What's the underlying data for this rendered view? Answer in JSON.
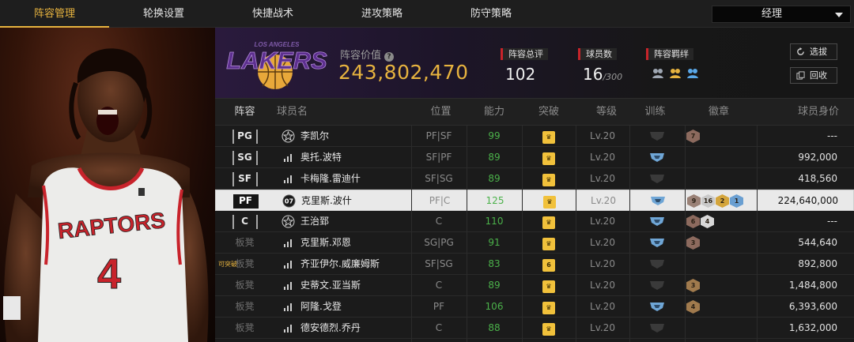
{
  "tabs": [
    {
      "label": "阵容管理",
      "active": true
    },
    {
      "label": "轮换设置",
      "active": false
    },
    {
      "label": "快捷战术",
      "active": false
    },
    {
      "label": "进攻策略",
      "active": false
    },
    {
      "label": "防守策略",
      "active": false
    }
  ],
  "role_select": {
    "value": "经理"
  },
  "player_art": {
    "jersey_text": "RAPTORS",
    "jersey_number": "4"
  },
  "team": {
    "logo_text": "LAKERS",
    "logo_subtext": "LOS ANGELES",
    "value_label": "阵容价值",
    "value": "243,802,470",
    "stats": {
      "overall_label": "阵容总评",
      "overall_value": "102",
      "players_label": "球员数",
      "players_value": "16",
      "players_max": "/300",
      "bond_label": "阵容羁绊"
    },
    "buttons": {
      "select": "选拔",
      "recycle": "回收"
    }
  },
  "table": {
    "headers": [
      "阵容",
      "球员名",
      "位置",
      "能力",
      "突破",
      "等级",
      "训练",
      "徽章",
      "球员身价"
    ],
    "breakable_tag": "可突破",
    "rows": [
      {
        "slot": "PG",
        "name": "李凯尔",
        "position": "PF|SF",
        "rating": "99",
        "breakthrough": "",
        "level": "Lv.20",
        "train": "grey",
        "badges": [
          "7"
        ],
        "badge_colors": [
          "#8c6a5e"
        ],
        "value": "---",
        "rank_icon": "star"
      },
      {
        "slot": "SG",
        "name": "奥托.波特",
        "position": "SF|PF",
        "rating": "89",
        "breakthrough": "",
        "level": "Lv.20",
        "train": "blue",
        "badges": [],
        "badge_colors": [],
        "value": "992,000",
        "rank_icon": "bars"
      },
      {
        "slot": "SF",
        "name": "卡梅隆.雷迪什",
        "position": "SF|SG",
        "rating": "89",
        "breakthrough": "",
        "level": "Lv.20",
        "train": "grey",
        "badges": [],
        "badge_colors": [],
        "value": "418,560",
        "rank_icon": "bars"
      },
      {
        "slot": "PF",
        "name": "克里斯.波什",
        "position": "PF|C",
        "rating": "125",
        "breakthrough": "",
        "level": "Lv.20",
        "train": "blue",
        "badges": [
          "9",
          "16",
          "2",
          "1"
        ],
        "badge_colors": [
          "#9a8176",
          "#c9c9c9",
          "#d4a53c",
          "#6a9fd1"
        ],
        "value": "224,640,000",
        "rank_icon": "num",
        "rank_num": "07",
        "selected": true
      },
      {
        "slot": "C",
        "name": "王治郅",
        "position": "C",
        "rating": "110",
        "breakthrough": "",
        "level": "Lv.20",
        "train": "blue",
        "badges": [
          "6",
          "4"
        ],
        "badge_colors": [
          "#8c6a5e",
          "#d8d8d8"
        ],
        "value": "---",
        "rank_icon": "star"
      },
      {
        "slot": "板凳",
        "name": "克里斯.邓恩",
        "position": "SG|PG",
        "rating": "91",
        "breakthrough": "",
        "level": "Lv.20",
        "train": "blue",
        "badges": [
          "3"
        ],
        "badge_colors": [
          "#8c6a5e"
        ],
        "value": "544,640",
        "rank_icon": "bars"
      },
      {
        "slot": "板凳",
        "name": "齐亚伊尔.威廉姆斯",
        "position": "SF|SG",
        "rating": "83",
        "breakthrough": "6",
        "level": "Lv.20",
        "train": "grey",
        "badges": [],
        "badge_colors": [],
        "value": "892,800",
        "rank_icon": "bars"
      },
      {
        "slot": "板凳",
        "name": "史蒂文.亚当斯",
        "position": "C",
        "rating": "89",
        "breakthrough": "",
        "level": "Lv.20",
        "train": "grey",
        "badges": [
          "3"
        ],
        "badge_colors": [
          "#a07a4d"
        ],
        "value": "1,484,800",
        "rank_icon": "bars"
      },
      {
        "slot": "板凳",
        "name": "阿隆.戈登",
        "position": "PF",
        "rating": "106",
        "breakthrough": "",
        "level": "Lv.20",
        "train": "blue",
        "badges": [
          "4"
        ],
        "badge_colors": [
          "#a07a4d"
        ],
        "value": "6,393,600",
        "rank_icon": "bars"
      },
      {
        "slot": "板凳",
        "name": "德安德烈.乔丹",
        "position": "C",
        "rating": "88",
        "breakthrough": "",
        "level": "Lv.20",
        "train": "grey",
        "badges": [],
        "badge_colors": [],
        "value": "1,632,000",
        "rank_icon": "bars"
      }
    ]
  }
}
